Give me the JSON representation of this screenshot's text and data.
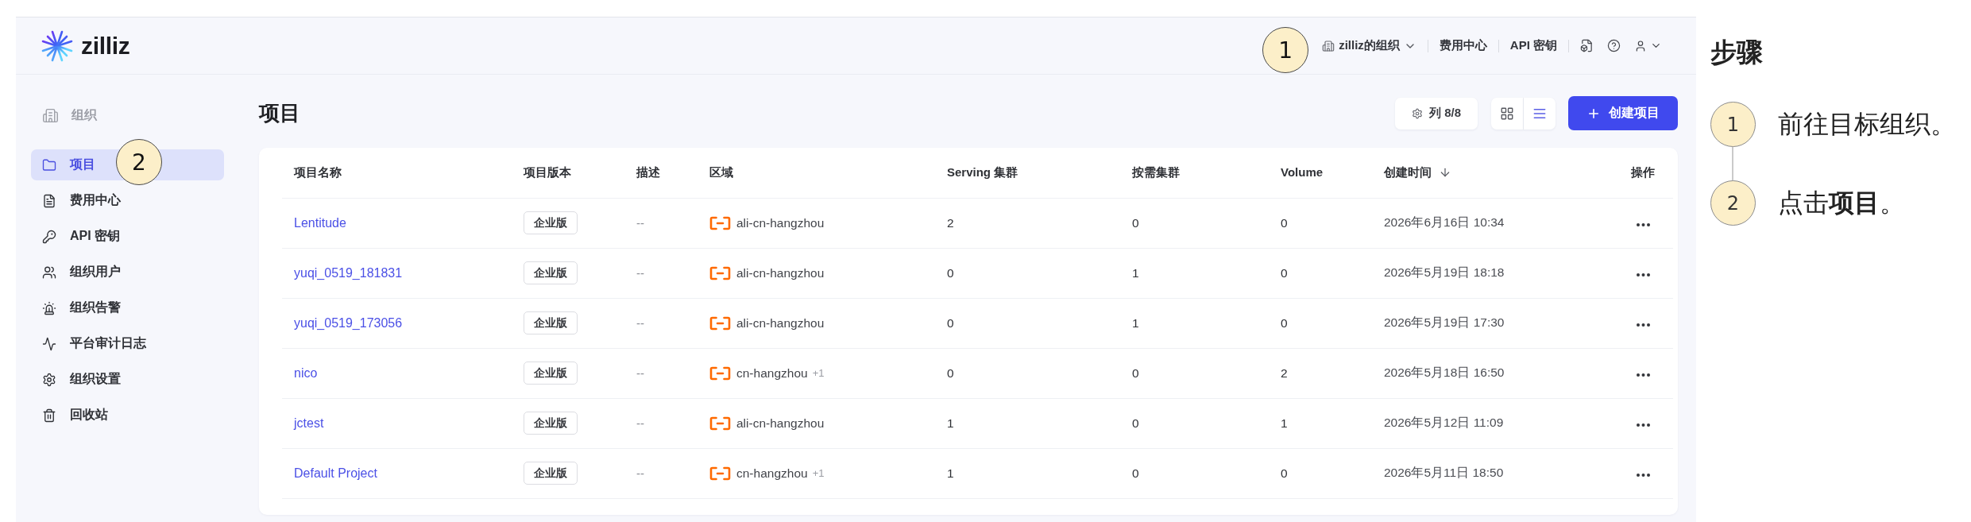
{
  "header": {
    "logo": "zilliz",
    "callout": "1",
    "org_selector": "zilliz的组织",
    "links": [
      "费用中心",
      "API 密钥"
    ]
  },
  "sidebar": {
    "section": "组织",
    "items": [
      {
        "label": "项目",
        "selected": true,
        "callout": "2"
      },
      {
        "label": "费用中心",
        "selected": false
      },
      {
        "label": "API 密钥",
        "selected": false
      },
      {
        "label": "组织用户",
        "selected": false
      },
      {
        "label": "组织告警",
        "selected": false
      },
      {
        "label": "平台审计日志",
        "selected": false
      },
      {
        "label": "组织设置",
        "selected": false
      },
      {
        "label": "回收站",
        "selected": false
      }
    ]
  },
  "page": {
    "title": "项目"
  },
  "toolbar": {
    "columns_button": "列 8/8",
    "view_toggle": [
      {
        "kind": "grid",
        "selected": false
      },
      {
        "kind": "list",
        "selected": true
      }
    ],
    "create_button": "创建项目"
  },
  "table": {
    "columns": [
      {
        "label": "项目名称",
        "sorted": false
      },
      {
        "label": "项目版本",
        "sorted": false
      },
      {
        "label": "描述",
        "sorted": false
      },
      {
        "label": "区域",
        "sorted": false
      },
      {
        "label": "Serving 集群",
        "sorted": false
      },
      {
        "label": "按需集群",
        "sorted": false
      },
      {
        "label": "Volume",
        "sorted": false
      },
      {
        "label": "创建时间",
        "sorted": true
      },
      {
        "label": "操作",
        "sorted": false
      }
    ],
    "rows": [
      {
        "name": "Lentitude",
        "edition": "企业版",
        "description": "--",
        "region": "ali-cn-hangzhou",
        "serving_clusters": "2",
        "on_demand_clusters": "0",
        "volume": "0",
        "created": "2026年6月16日 10:34"
      },
      {
        "name": "yuqi_0519_181831",
        "edition": "企业版",
        "description": "--",
        "region": "ali-cn-hangzhou",
        "serving_clusters": "0",
        "on_demand_clusters": "1",
        "volume": "0",
        "created": "2026年5月19日 18:18"
      },
      {
        "name": "yuqi_0519_173056",
        "edition": "企业版",
        "description": "--",
        "region": "ali-cn-hangzhou",
        "serving_clusters": "0",
        "on_demand_clusters": "1",
        "volume": "0",
        "created": "2026年5月19日 17:30"
      },
      {
        "name": "nico",
        "edition": "企业版",
        "description": "--",
        "region": "cn-hangzhou",
        "region_extra": "+1",
        "serving_clusters": "0",
        "on_demand_clusters": "0",
        "volume": "2",
        "created": "2026年5月18日 16:50"
      },
      {
        "name": "jctest",
        "edition": "企业版",
        "description": "--",
        "region": "ali-cn-hangzhou",
        "serving_clusters": "1",
        "on_demand_clusters": "0",
        "volume": "1",
        "created": "2026年5月12日 11:09"
      },
      {
        "name": "Default Project",
        "edition": "企业版",
        "description": "--",
        "region": "cn-hangzhou",
        "region_extra": "+1",
        "serving_clusters": "1",
        "on_demand_clusters": "0",
        "volume": "0",
        "created": "2026年5月11日 18:50"
      }
    ]
  },
  "steps": {
    "title": "步骤",
    "items": [
      {
        "number": "1",
        "text": "前往目标组织。"
      },
      {
        "number": "2",
        "text": "点击**项目**。"
      }
    ]
  }
}
